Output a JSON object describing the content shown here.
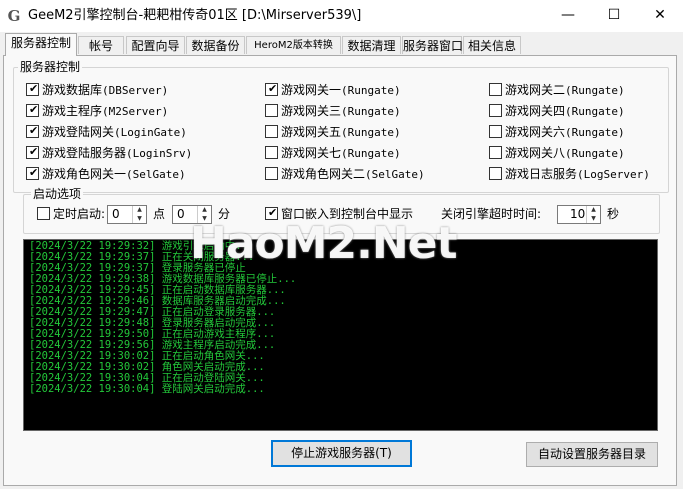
{
  "window": {
    "title": "GeeM2引擎控制台-耙耙柑传奇01区 [D:\\Mirserver539\\]",
    "app_icon_glyph": "G",
    "minimize_glyph": "—",
    "maximize_glyph": "☐",
    "close_glyph": "✕"
  },
  "tabs": [
    {
      "label": "服务器控制"
    },
    {
      "label": "帐号"
    },
    {
      "label": "配置向导"
    },
    {
      "label": "数据备份"
    },
    {
      "label": "HeroM2版本转换"
    },
    {
      "label": "数据清理"
    },
    {
      "label": "服务器窗口"
    },
    {
      "label": "相关信息"
    }
  ],
  "server_control": {
    "group_label": "服务器控制",
    "checkboxes": [
      {
        "label": "游戏数据库",
        "tag": "(DBServer)",
        "checked": true
      },
      {
        "label": "游戏主程序",
        "tag": "(M2Server)",
        "checked": true
      },
      {
        "label": "游戏登陆网关",
        "tag": "(LoginGate)",
        "checked": true
      },
      {
        "label": "游戏登陆服务器",
        "tag": "(LoginSrv)",
        "checked": true
      },
      {
        "label": "游戏角色网关一",
        "tag": "(SelGate)",
        "checked": true
      },
      {
        "label": "游戏网关一",
        "tag": "(Rungate)",
        "checked": true
      },
      {
        "label": "游戏网关三",
        "tag": "(Rungate)",
        "checked": false
      },
      {
        "label": "游戏网关五",
        "tag": "(Rungate)",
        "checked": false
      },
      {
        "label": "游戏网关七",
        "tag": "(Rungate)",
        "checked": false
      },
      {
        "label": "游戏角色网关二",
        "tag": "(SelGate)",
        "checked": false
      },
      {
        "label": "游戏网关二",
        "tag": "(Rungate)",
        "checked": false
      },
      {
        "label": "游戏网关四",
        "tag": "(Rungate)",
        "checked": false
      },
      {
        "label": "游戏网关六",
        "tag": "(Rungate)",
        "checked": false
      },
      {
        "label": "游戏网关八",
        "tag": "(Rungate)",
        "checked": false
      },
      {
        "label": "游戏日志服务",
        "tag": "(LogServer)",
        "checked": false
      }
    ]
  },
  "startup": {
    "group_label": "启动选项",
    "timed_start_label": "定时启动:",
    "timed_start_checked": false,
    "hour_value": "0",
    "hour_unit": "点",
    "minute_value": "0",
    "minute_unit": "分",
    "embed_label": "窗口嵌入到控制台中显示",
    "embed_checked": true,
    "timeout_label": "关闭引擎超时时间:",
    "timeout_value": "10",
    "timeout_unit": "秒"
  },
  "log": {
    "lines": [
      "[2024/3/22 19:29:32] 游戏引擎启动中...",
      "[2024/3/22 19:29:37] 正在关闭服务器...",
      "[2024/3/22 19:29:37] 登录服务器已停止",
      "[2024/3/22 19:29:38] 游戏数据库服务器已停止...",
      "[2024/3/22 19:29:45] 正在启动数据库服务器...",
      "[2024/3/22 19:29:46] 数据库服务器启动完成...",
      "[2024/3/22 19:29:47] 正在启动登录服务器...",
      "[2024/3/22 19:29:48] 登录服务器启动完成...",
      "[2024/3/22 19:29:50] 正在启动游戏主程序...",
      "[2024/3/22 19:29:56] 游戏主程序启动完成...",
      "[2024/3/22 19:30:02] 正在启动角色网关...",
      "[2024/3/22 19:30:02] 角色网关启动完成...",
      "[2024/3/22 19:30:04] 正在启动登陆网关...",
      "[2024/3/22 19:30:04] 登陆网关启动完成..."
    ]
  },
  "watermark": "HaoM2.Net",
  "buttons": {
    "stop_server": "停止游戏服务器(T)",
    "auto_config": "自动设置服务器目录"
  },
  "colors": {
    "log_text": "#23c83a",
    "log_background": "#000000",
    "default_button_border": "#0078d7"
  }
}
